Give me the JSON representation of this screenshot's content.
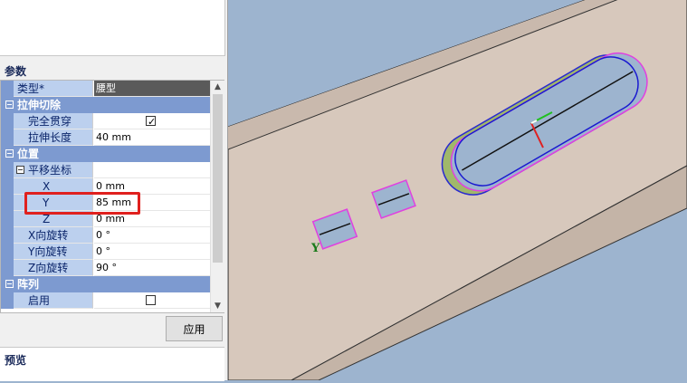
{
  "panel": {
    "params_title": "参数",
    "preview_title": "预览",
    "apply_label": "应用"
  },
  "grid": {
    "type_label": "类型*",
    "type_value": "腰型",
    "cat_extrude": "拉伸切除",
    "through_all_label": "完全贯穿",
    "through_all_checked": true,
    "length_label": "拉伸长度",
    "length_value": "40 mm",
    "cat_position": "位置",
    "translate_label": "平移坐标",
    "x_label": "X",
    "x_value": "0 mm",
    "y_label": "Y",
    "y_value": "85 mm",
    "z_label": "Z",
    "z_value": "0 mm",
    "xrot_label": "X向旋转",
    "xrot_value": "0 °",
    "yrot_label": "Y向旋转",
    "yrot_value": "0 °",
    "zrot_label": "Z向旋转",
    "zrot_value": "90 °",
    "cat_array": "阵列",
    "enable_label": "启用",
    "enable_checked": false
  },
  "viewport": {
    "axis_label": "Y",
    "background": "#9db4cf",
    "plate_color": "#d7c8bc"
  }
}
